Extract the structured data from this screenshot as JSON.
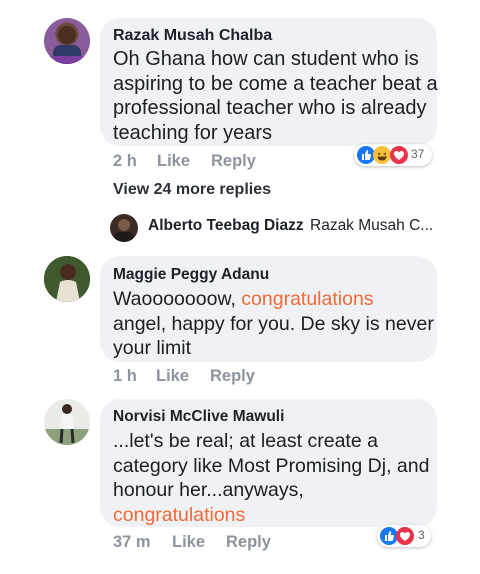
{
  "comments": [
    {
      "author": "Razak Musah Chalba",
      "lines": [
        "Oh Ghana how can student who is",
        "aspiring to be come a teacher beat a",
        "professional teacher who is already",
        "teaching for years"
      ],
      "time": "2 h",
      "like": "Like",
      "reply": "Reply",
      "reactions": [
        "like-reaction-icon",
        "haha-reaction-icon",
        "love-reaction-icon"
      ],
      "reaction_count": "37"
    },
    {
      "author": "Maggie Peggy Adanu",
      "line1_a": "Waooooooow, ",
      "line1_b": "congratulations",
      "line2": "angel, happy for you. De sky is never",
      "line3": "your limit",
      "time": "1 h",
      "like": "Like",
      "reply": "Reply"
    },
    {
      "author": "Norvisi McClive Mawuli",
      "lines": [
        "...let's be real; at least create a",
        "category like Most Promising Dj, and",
        "honour her...anyways,"
      ],
      "highlight": "congratulations",
      "time": "37 m",
      "like": "Like",
      "reply": "Reply",
      "reactions": [
        "like-reaction-icon",
        "love-reaction-icon"
      ],
      "reaction_count": "3"
    }
  ],
  "view_more_replies": "View 24 more replies",
  "reply_preview": {
    "author": "Alberto Teebag Diazz",
    "text": "Razak Musah C..."
  },
  "colors": {
    "bubble": "#eff1f4",
    "highlight": "#f06a38",
    "muted": "#8d949e",
    "like_blue": "#1877f2",
    "love_red": "#e8334a",
    "haha_yellow": "#f7c23b"
  }
}
